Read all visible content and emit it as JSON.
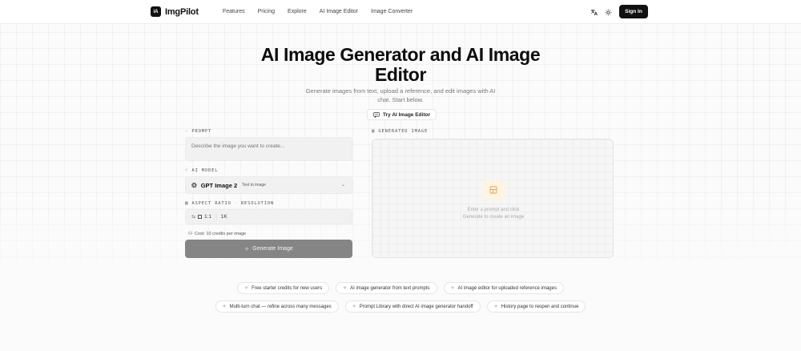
{
  "nav": {
    "logo_mark": "iA",
    "logo_text": "ImgPilot",
    "links": [
      "Features",
      "Pricing",
      "Explore",
      "AI Image Editor",
      "Image Converter"
    ],
    "translate_icon": "translate-icon",
    "theme_icon": "sun-icon",
    "signin_label": "Sign In"
  },
  "hero": {
    "title_line1": "AI Image Generator and AI Image",
    "title_line2": "Editor",
    "subtitle_line1": "Generate images from text, upload a reference, and edit images with AI",
    "subtitle_line2": "chat. Start below.",
    "try_label": "Try AI Image Editor"
  },
  "form": {
    "prompt_label": "PROMPT",
    "prompt_placeholder": "Describe the image you want to create...",
    "model_label": "AI MODEL",
    "model_name": "GPT Image 2",
    "model_tag": "Text to image",
    "aspect_label": "ASPECT RATIO",
    "resolution_label": "RESOLUTION",
    "label_separator": "·",
    "aspect_value": "1:1",
    "resolution_value": "1K",
    "cost_text": "Cost: 10 credits per image",
    "generate_label": "Generate Image"
  },
  "preview": {
    "label": "GENERATED IMAGE",
    "placeholder_line1": "Enter a prompt and click",
    "placeholder_line2": "Generate to create an image"
  },
  "chips_row1": [
    "Free starter credits for new users",
    "AI image generator from text prompts",
    "AI image editor for uploaded reference images"
  ],
  "chips_row2": [
    "Multi-turn chat — refine across many messages",
    "Prompt Library with direct AI image generator handoff",
    "History page to reopen and continue"
  ],
  "colors": {
    "accent": "#e79a3c",
    "button_disabled": "#858585",
    "primary_dark": "#111111"
  }
}
